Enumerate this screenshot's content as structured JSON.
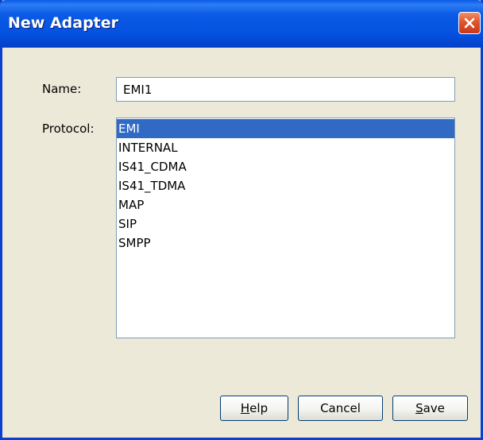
{
  "window": {
    "title": "New Adapter",
    "close_icon": "close-icon"
  },
  "form": {
    "name_label": "Name:",
    "name_value": "EMI1",
    "protocol_label": "Protocol:",
    "protocol_options": [
      "EMI",
      "INTERNAL",
      "IS41_CDMA",
      "IS41_TDMA",
      "MAP",
      "SIP",
      "SMPP"
    ],
    "protocol_selected": "EMI"
  },
  "buttons": {
    "help": {
      "mnemonic": "H",
      "rest": "elp"
    },
    "cancel": {
      "label": "Cancel"
    },
    "save": {
      "mnemonic": "S",
      "rest": "ave"
    }
  },
  "colors": {
    "titlebar": "#0a5be6",
    "selection": "#316ac5",
    "dialog_bg": "#ece9d8",
    "close_button": "#e0542a"
  }
}
